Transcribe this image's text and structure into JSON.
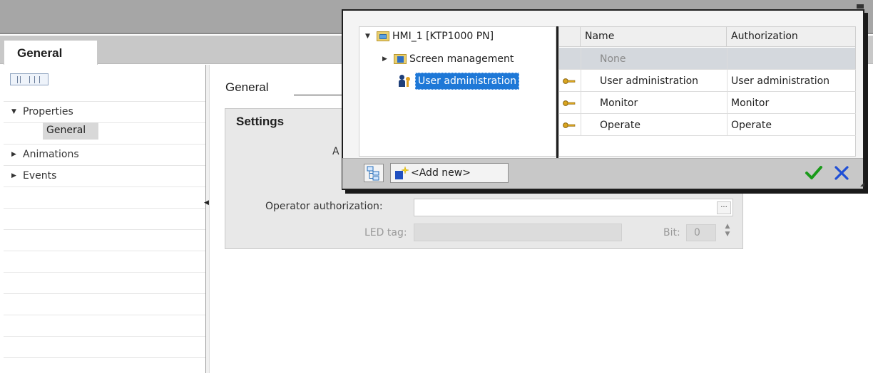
{
  "tabs": {
    "general": "General"
  },
  "left_tree": {
    "properties": "Properties",
    "general": "General",
    "animations": "Animations",
    "events": "Events"
  },
  "main": {
    "section_title": "General",
    "settings_title": "Settings",
    "truncated_label": "A",
    "operator_authorization_label": "Operator authorization:",
    "operator_authorization_value": "",
    "browse_label": "...",
    "led_tag_label": "LED tag:",
    "led_tag_value": "",
    "bit_label": "Bit:",
    "bit_value": "0"
  },
  "popup": {
    "tree": {
      "root": "HMI_1 [KTP1000 PN]",
      "screen_management": "Screen management",
      "user_administration": "User administration"
    },
    "table": {
      "headers": [
        "Name",
        "Authorization"
      ],
      "rows": [
        {
          "name": "None",
          "authorization": ""
        },
        {
          "name": "User administration",
          "authorization": "User administration"
        },
        {
          "name": "Monitor",
          "authorization": "Monitor"
        },
        {
          "name": "Operate",
          "authorization": "Operate"
        }
      ]
    },
    "add_new": "<Add new>"
  },
  "colors": {
    "selection": "#1e78d7",
    "ok_green": "#1a9a1a",
    "cancel_blue": "#1f4fd6"
  }
}
